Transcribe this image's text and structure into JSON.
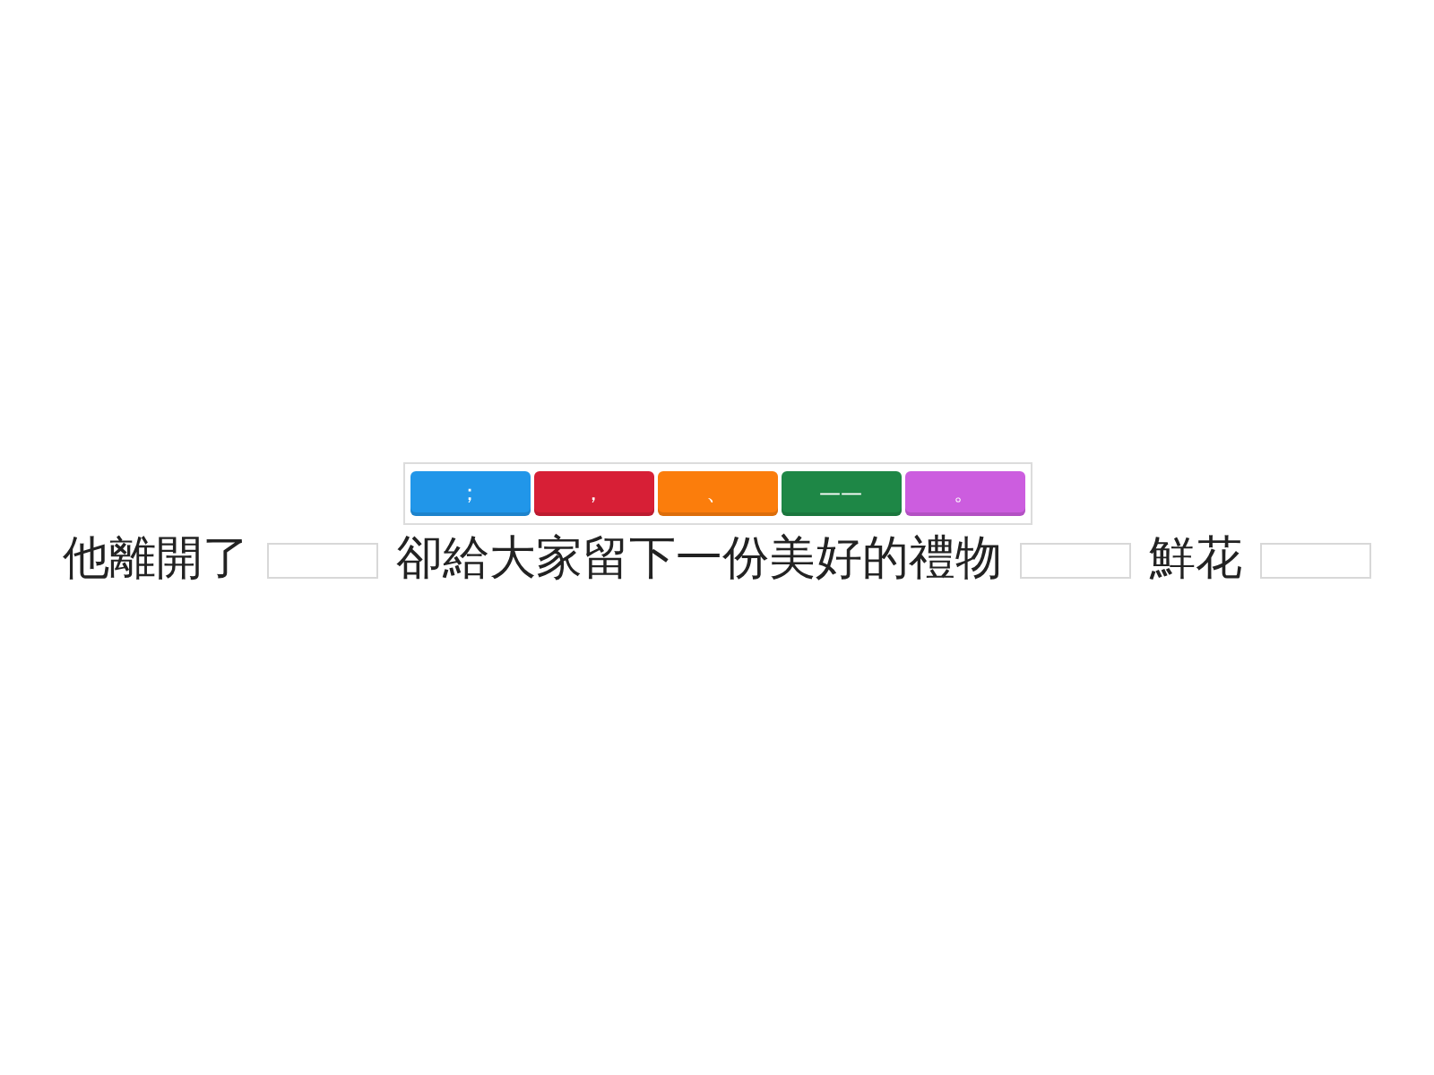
{
  "tiles": [
    {
      "text": "；",
      "color": "#2196e9"
    },
    {
      "text": "，",
      "color": "#d71f36"
    },
    {
      "text": "、",
      "color": "#fb7d0c"
    },
    {
      "text": "——",
      "color": "#1e8746"
    },
    {
      "text": "。",
      "color": "#cc5ddf"
    }
  ],
  "sentence": [
    {
      "kind": "text",
      "text": "他離開了"
    },
    {
      "kind": "blank"
    },
    {
      "kind": "text",
      "text": "卻給大家留下一份美好的禮物"
    },
    {
      "kind": "blank"
    },
    {
      "kind": "text",
      "text": "鮮花"
    },
    {
      "kind": "blank"
    }
  ]
}
